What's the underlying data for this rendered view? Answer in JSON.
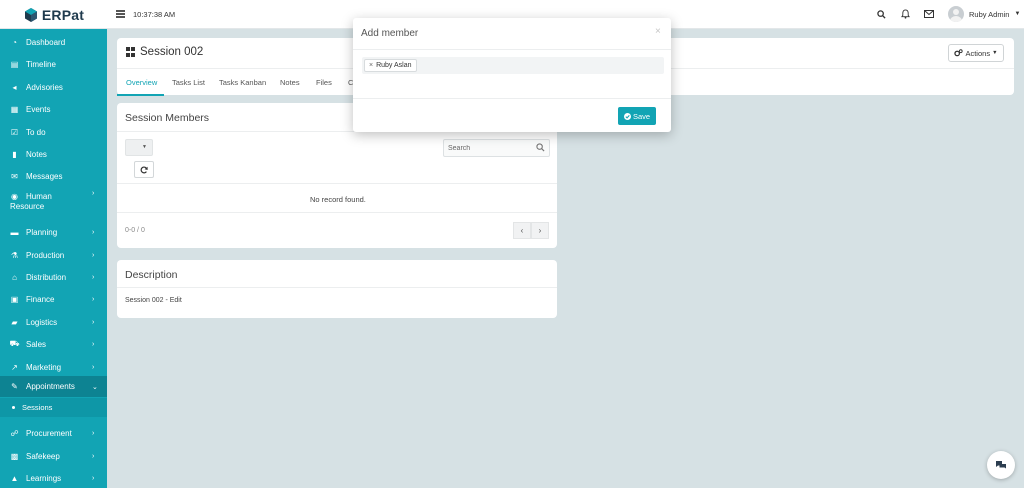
{
  "topbar": {
    "logo_text": "ERPat",
    "clock": "10:37:38 AM",
    "user_name": "Ruby Admin"
  },
  "sidebar": {
    "items": [
      {
        "label": "Dashboard",
        "icon": "dashboard-icon",
        "has_children": false
      },
      {
        "label": "Timeline",
        "icon": "timeline-icon",
        "has_children": false
      },
      {
        "label": "Advisories",
        "icon": "bullhorn-icon",
        "has_children": false
      },
      {
        "label": "Events",
        "icon": "calendar-icon",
        "has_children": false
      },
      {
        "label": "To do",
        "icon": "checkbox-icon",
        "has_children": false
      },
      {
        "label": "Notes",
        "icon": "note-icon",
        "has_children": false
      },
      {
        "label": "Messages",
        "icon": "envelope-icon",
        "has_children": false
      },
      {
        "label": "Human",
        "label2": "Resource",
        "icon": "users-icon",
        "has_children": true
      },
      {
        "label": "Planning",
        "icon": "briefcase-icon",
        "has_children": true
      },
      {
        "label": "Production",
        "icon": "flask-icon",
        "has_children": true
      },
      {
        "label": "Distribution",
        "icon": "bank-icon",
        "has_children": true
      },
      {
        "label": "Finance",
        "icon": "money-icon",
        "has_children": true
      },
      {
        "label": "Logistics",
        "icon": "truck-icon",
        "has_children": true
      },
      {
        "label": "Sales",
        "icon": "cart-icon",
        "has_children": true
      },
      {
        "label": "Marketing",
        "icon": "chart-icon",
        "has_children": true
      },
      {
        "label": "Appointments",
        "icon": "edit-icon",
        "has_children": true,
        "active": true
      },
      {
        "label": "Procurement",
        "icon": "handshake-icon",
        "has_children": true
      },
      {
        "label": "Safekeep",
        "icon": "archive-icon",
        "has_children": true
      },
      {
        "label": "Learnings",
        "icon": "graduation-cap-icon",
        "has_children": true
      }
    ],
    "sub_item": "Sessions"
  },
  "page": {
    "title": "Session 002",
    "actions_label": "Actions",
    "tabs": [
      "Overview",
      "Tasks List",
      "Tasks Kanban",
      "Notes",
      "Files",
      "C"
    ]
  },
  "members_card": {
    "title": "Session Members",
    "search_placeholder": "Search",
    "empty_text": "No record found.",
    "pager_info": "0-0 / 0"
  },
  "description_card": {
    "title": "Description",
    "text": "Session 002 - Edit"
  },
  "modal": {
    "title": "Add member",
    "close_glyph": "×",
    "tag_label": "Ruby Aslan",
    "tag_remove": "×",
    "save_label": "Save"
  },
  "colors": {
    "accent": "#12a4b4",
    "sidebar_active": "#0d8392",
    "background": "#d6e1e4"
  }
}
